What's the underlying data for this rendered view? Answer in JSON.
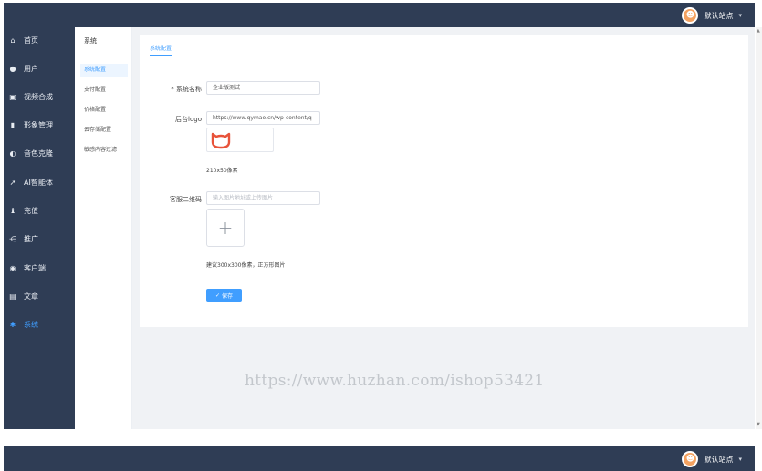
{
  "header": {
    "user_name": "默认站点",
    "caret": "▾"
  },
  "sidebar": {
    "items": [
      {
        "label": "首页",
        "icon": "home-icon",
        "glyph": "⌂"
      },
      {
        "label": "用户",
        "icon": "user-icon",
        "glyph": "●"
      },
      {
        "label": "视频合成",
        "icon": "video-icon",
        "glyph": "▣"
      },
      {
        "label": "形象管理",
        "icon": "avatar-manage-icon",
        "glyph": "▮"
      },
      {
        "label": "音色克隆",
        "icon": "voice-icon",
        "glyph": "◐"
      },
      {
        "label": "AI智能体",
        "icon": "ai-icon",
        "glyph": "➚"
      },
      {
        "label": "充值",
        "icon": "recharge-icon",
        "glyph": "♝"
      },
      {
        "label": "推广",
        "icon": "share-icon",
        "glyph": "⋲"
      },
      {
        "label": "客户端",
        "icon": "client-icon",
        "glyph": "◉"
      },
      {
        "label": "文章",
        "icon": "article-icon",
        "glyph": "▤"
      },
      {
        "label": "系统",
        "icon": "gear-icon",
        "glyph": "✱"
      }
    ]
  },
  "subnav": {
    "title": "系统",
    "items": [
      {
        "label": "系统配置"
      },
      {
        "label": "支付配置"
      },
      {
        "label": "价格配置"
      },
      {
        "label": "云存储配置"
      },
      {
        "label": "敏感内容过滤"
      }
    ]
  },
  "form": {
    "tab_label": "系统配置",
    "system_name_label": "* 系统名称",
    "system_name_value": "企业版测试",
    "logo_label": "后台logo",
    "logo_url_value": "https://www.qymao.cn/wp-content/q",
    "logo_hint": "210x50像素",
    "qrcode_label": "客服二维码",
    "qrcode_placeholder": "输入图片地址或上传图片",
    "upload_plus": "+",
    "qrcode_hint": "建议300x300像素，正方形图片",
    "save_label": "保存",
    "save_check": "✓"
  },
  "watermark": "https://www.huzhan.com/ishop53421",
  "colors": {
    "sidebar_bg": "#2f3d55",
    "accent": "#409eff"
  }
}
